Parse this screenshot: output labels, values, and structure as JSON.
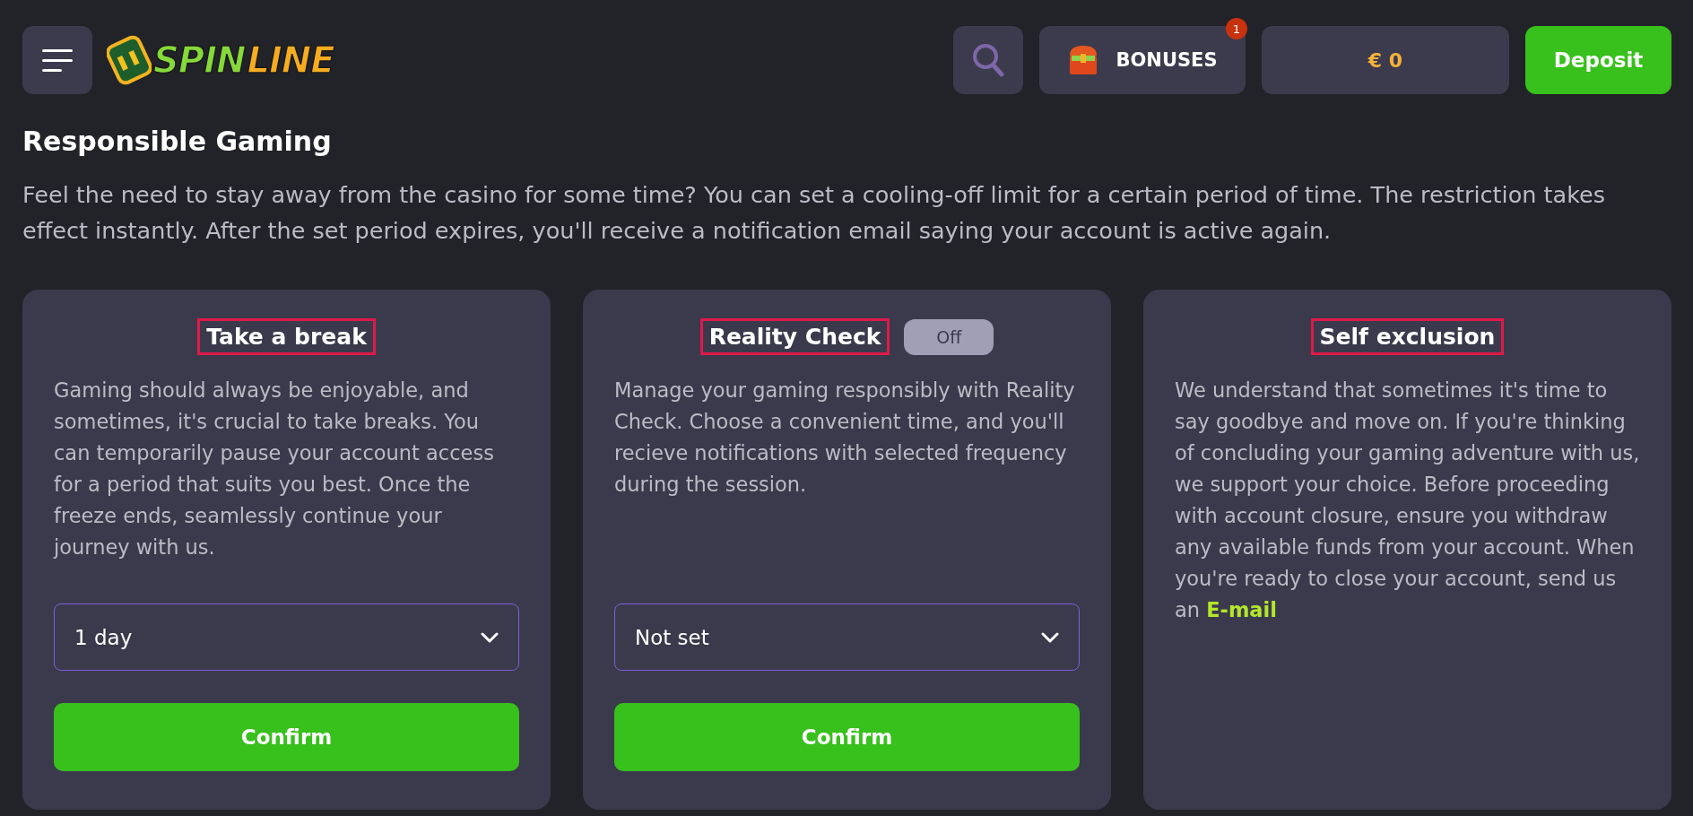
{
  "header": {
    "logo": {
      "part_1": "SPIN",
      "part_2": "LINE"
    },
    "bonuses": {
      "label": "BONUSES",
      "badge": "1"
    },
    "balance": "€ 0",
    "deposit": "Deposit"
  },
  "page": {
    "title": "Responsible Gaming",
    "intro": "Feel the need to stay away from the casino for some time? You can set a cooling-off limit for a certain period of time. The restriction takes effect instantly. After the set period expires, you'll receive a notification email saying your account is active again."
  },
  "cards": [
    {
      "kind": "select",
      "title": "Take a break",
      "highlighted": true,
      "text": "Gaming should always be enjoyable, and sometimes, it's crucial to take breaks. You can temporarily pause your account access for a period that suits you best. Once the freeze ends, seamlessly continue your journey with us.",
      "select": "1 day",
      "button": "Confirm"
    },
    {
      "kind": "select",
      "title": "Reality Check",
      "highlighted": true,
      "toggle": {
        "label": "Off",
        "on": false
      },
      "text": "Manage your gaming responsibly with Reality Check. Choose a convenient time, and you'll recieve notifications with selected frequency during the session.",
      "select": "Not set",
      "button": "Confirm"
    },
    {
      "kind": "info",
      "title": "Self exclusion",
      "highlighted": true,
      "text": "We understand that sometimes it's time to say goodbye and move on. If you're thinking of concluding your gaming adventure with us, we support your choice. Before proceeding with account closure, ensure you withdraw any available funds from your account. When you're ready to close your account, send us an",
      "link": "E-mail"
    }
  ]
}
